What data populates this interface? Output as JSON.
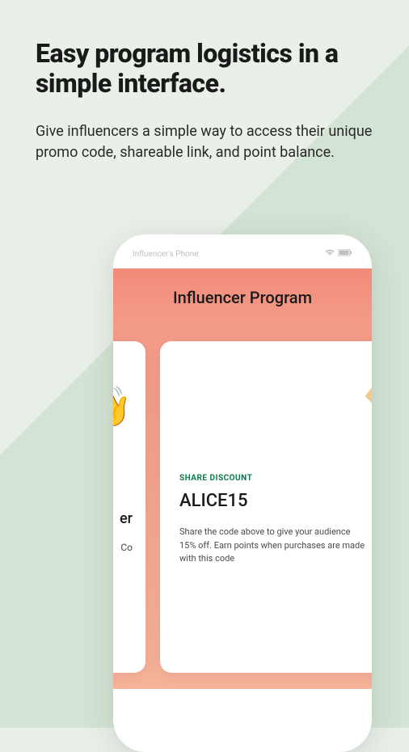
{
  "headline": "Easy program logistics in a simple interface.",
  "subheadline": "Give influencers a simple way to access their unique promo code, shareable link, and point balance.",
  "phone": {
    "status_label": "Influencer's Phone",
    "header_title": "Influencer Program",
    "card_left": {
      "emoji": "👋",
      "text1": "er",
      "text2": "Co"
    },
    "card_right": {
      "share_label": "SHARE DISCOUNT",
      "promo_code": "ALICE15",
      "description": "Share the code above to give your audience 15% off. Earn points when purchases are made with this code"
    }
  }
}
